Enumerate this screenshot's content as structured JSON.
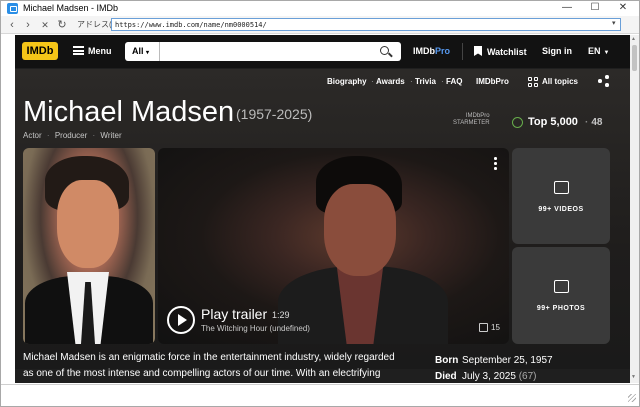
{
  "window": {
    "title": "Michael Madsen - IMDb",
    "controls": {
      "minimize": "—",
      "maximize": "☐",
      "close": "✕"
    }
  },
  "addressbar": {
    "back": "‹",
    "forward": "›",
    "stop": "✕",
    "refresh": "↻",
    "label": "アドレス(D)",
    "url": "https://www.imdb.com/name/nm0000514/",
    "dropdown": "▾"
  },
  "imdb_nav": {
    "logo": "IMDb",
    "menu": "Menu",
    "search_category": "All",
    "search_placeholder": "",
    "imdbpro_prefix": "IMDb",
    "imdbpro_suffix": "Pro",
    "watchlist": "Watchlist",
    "signin": "Sign in",
    "language": "EN"
  },
  "subnav": {
    "items": [
      "Biography",
      "Awards",
      "Trivia",
      "FAQ",
      "IMDbPro"
    ],
    "all_topics": "All topics"
  },
  "person": {
    "name": "Michael Madsen",
    "years": "(1957-2025)",
    "roles": [
      "Actor",
      "Producer",
      "Writer"
    ],
    "role_sep": "·",
    "starmeter_line1": "IMDbPro",
    "starmeter_line2": "STARMETER",
    "rank": "Top 5,000",
    "rank_delta_sep": "·",
    "rank_delta": "48"
  },
  "media": {
    "play_label": "Play trailer",
    "duration": "1:29",
    "trailer_title": "The Witching Hour (undefined)",
    "likes": "15",
    "videos_label": "99+ VIDEOS",
    "photos_label": "99+ PHOTOS"
  },
  "bio": {
    "line1": "Michael Madsen is an enigmatic force in the entertainment industry, widely regarded",
    "line2": "as one of the most intense and compelling actors of our time. With an electrifying"
  },
  "facts": {
    "born_label": "Born",
    "born_value": "September 25, 1957",
    "died_label": "Died",
    "died_value": "July 3, 2025",
    "died_age": "(67)"
  },
  "colors": {
    "imdb_yellow": "#f5c518",
    "imdbpro_blue": "#5799ef",
    "trend_green": "#67ad4b",
    "page_bg": "#1f1f1f"
  }
}
